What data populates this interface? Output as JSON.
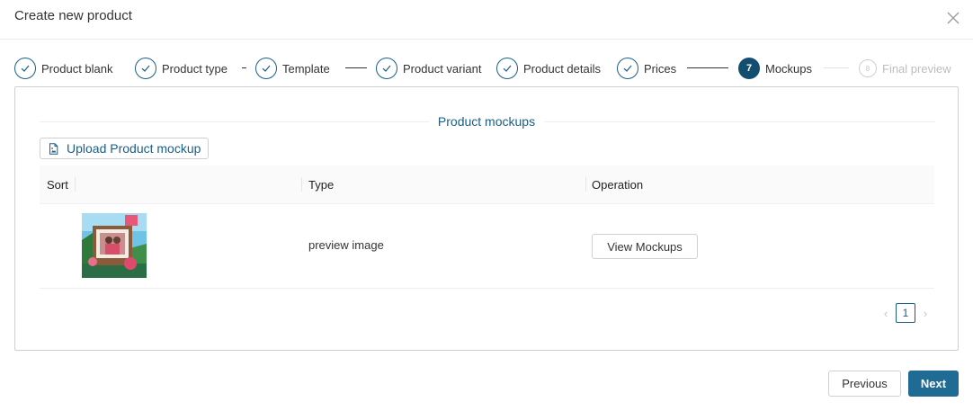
{
  "modal": {
    "title": "Create new product"
  },
  "steps": [
    {
      "label": "Product blank",
      "state": "done"
    },
    {
      "label": "Product type",
      "state": "done"
    },
    {
      "label": "Template",
      "state": "done"
    },
    {
      "label": "Product variant",
      "state": "done"
    },
    {
      "label": "Product details",
      "state": "done"
    },
    {
      "label": "Prices",
      "state": "done"
    },
    {
      "label": "Mockups",
      "state": "active",
      "number": "7"
    },
    {
      "label": "Final preview",
      "state": "pending",
      "number": "8"
    }
  ],
  "section": {
    "title": "Product mockups"
  },
  "upload": {
    "label": "Upload Product mockup",
    "icon": "file-image-icon"
  },
  "table": {
    "headers": {
      "sort": "Sort",
      "type": "Type",
      "operation": "Operation"
    },
    "rows": [
      {
        "image": "mockup-thumbnail",
        "type": "preview image",
        "operation_label": "View Mockups"
      }
    ]
  },
  "pagination": {
    "current": "1"
  },
  "footer": {
    "previous_label": "Previous",
    "next_label": "Next"
  },
  "colors": {
    "accent": "#1a5e88",
    "primary_button": "#1f6b94",
    "active_step": "#134e70"
  }
}
